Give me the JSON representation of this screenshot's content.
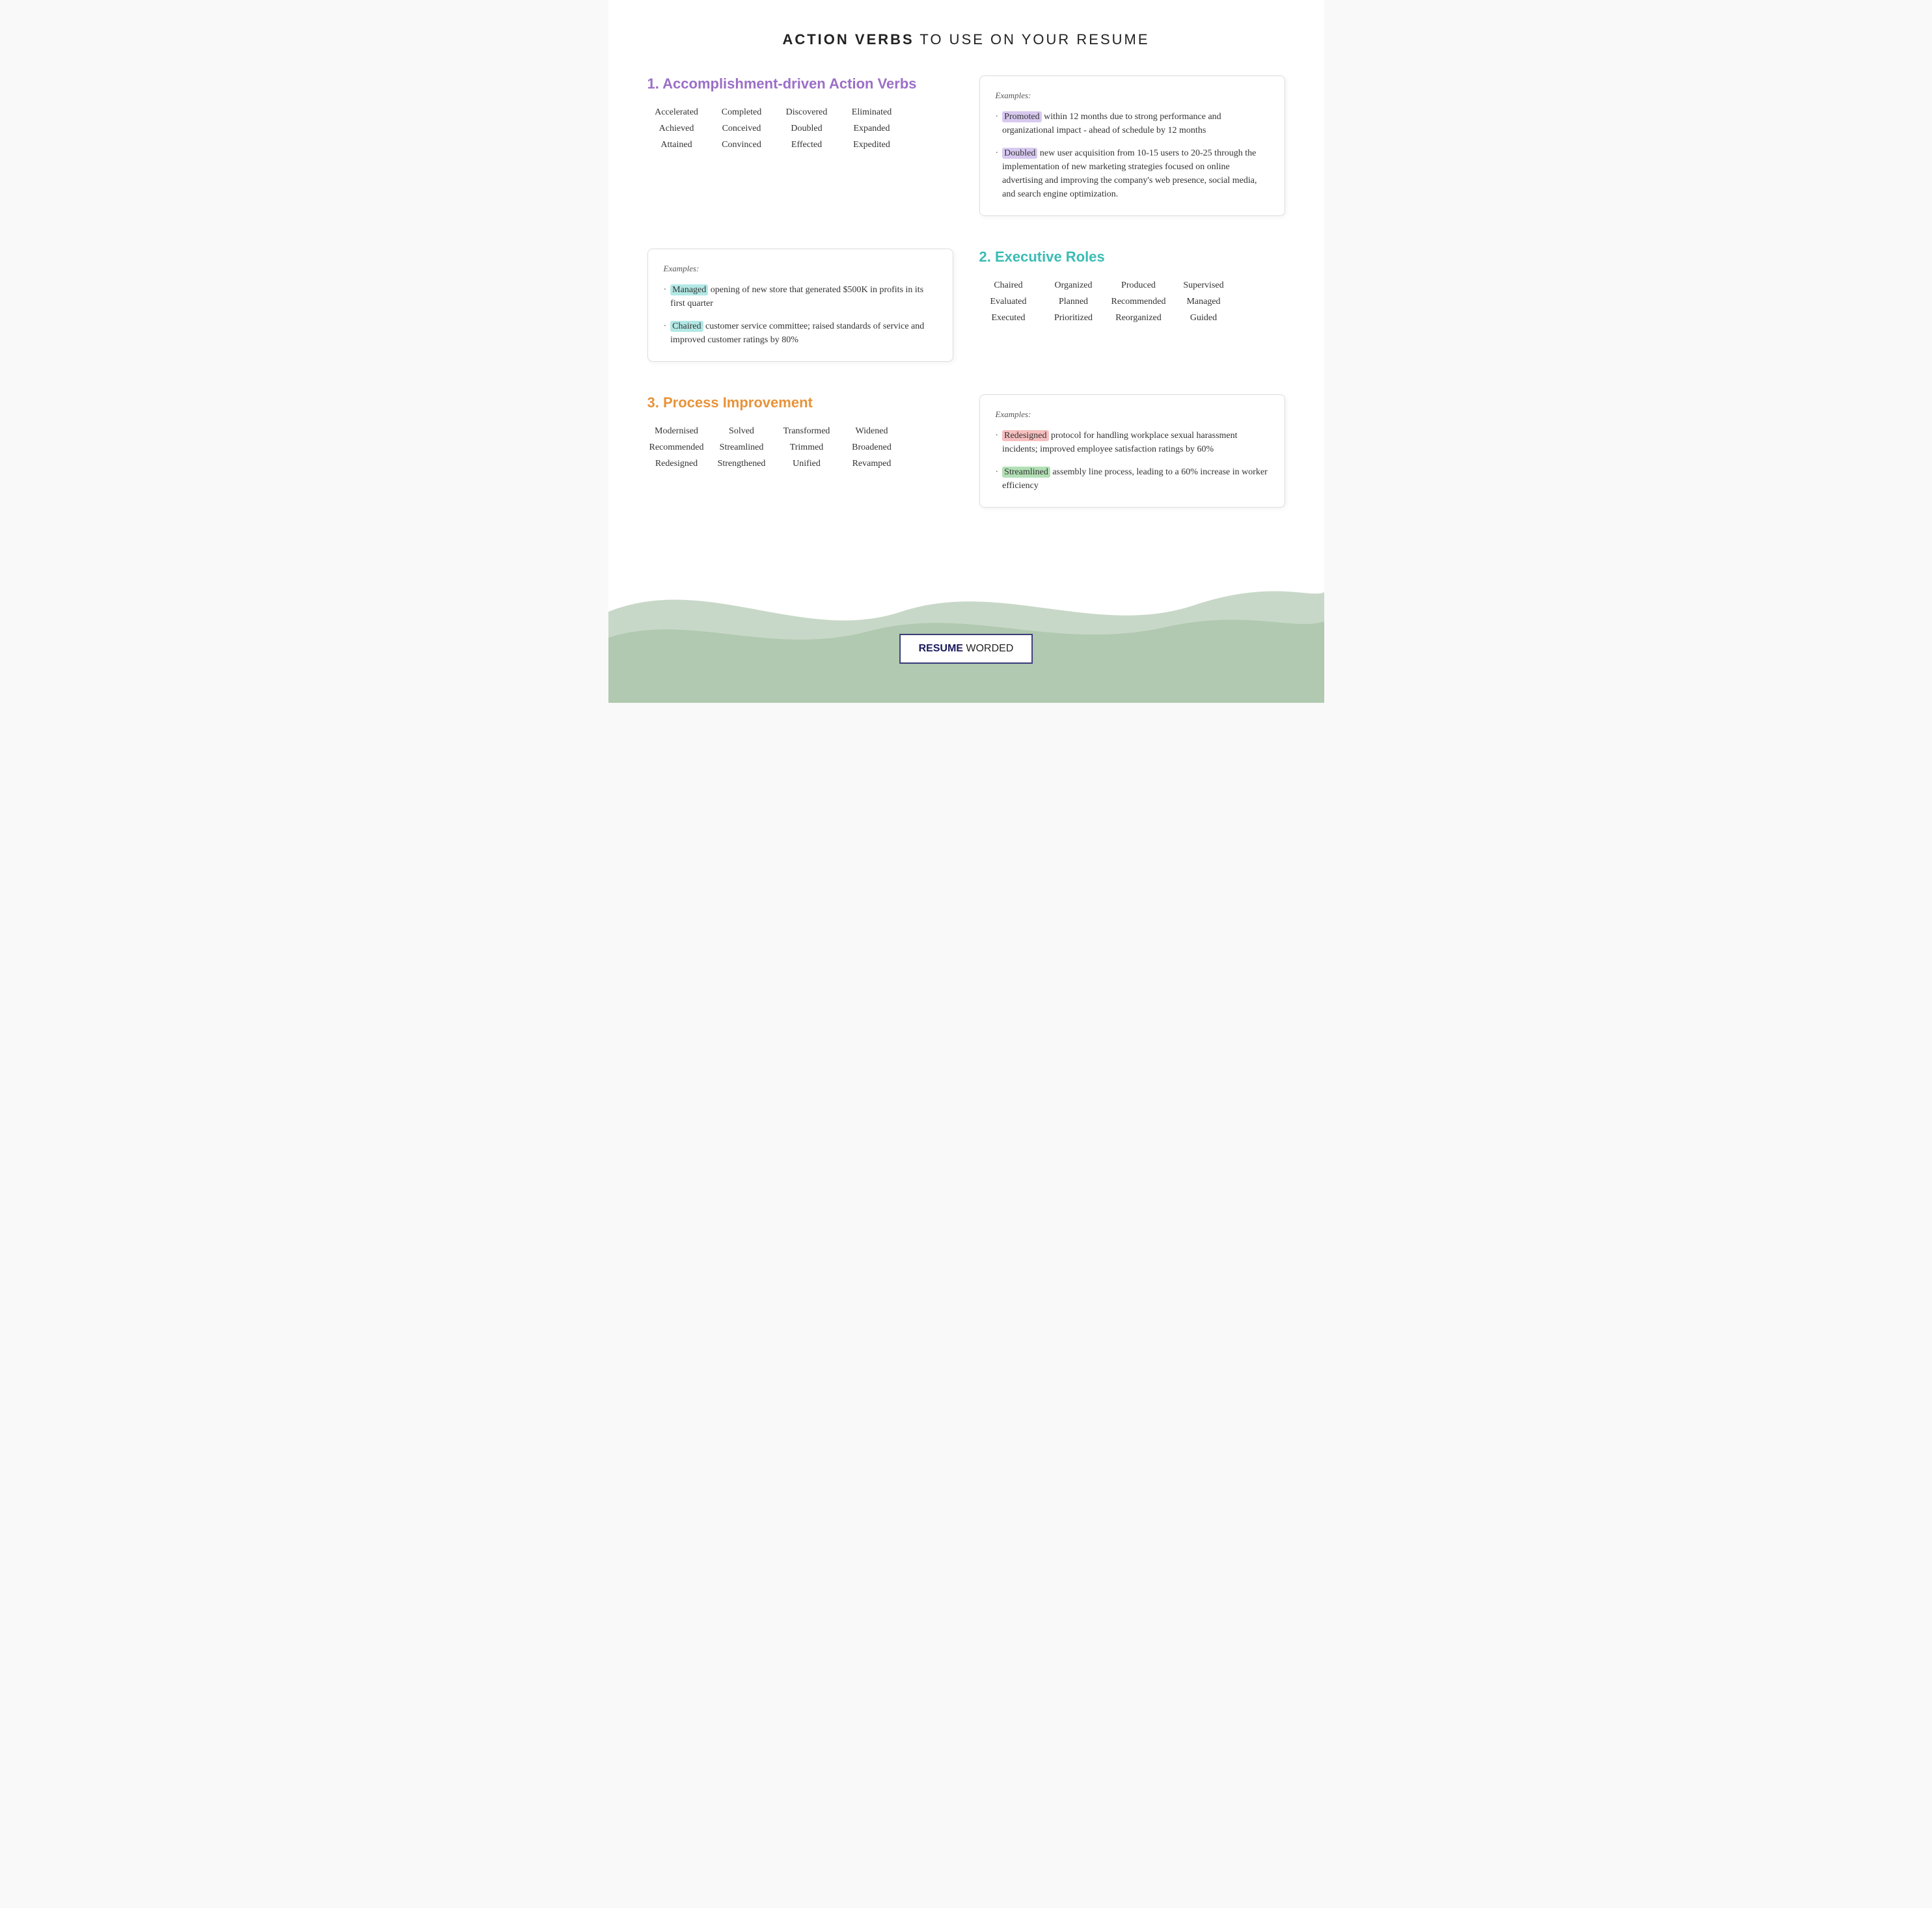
{
  "header": {
    "bold": "ACTION VERBS",
    "light": " TO USE ON YOUR RESUME"
  },
  "section1": {
    "title": "1. Accomplishment-driven Action Verbs",
    "color": "purple",
    "words": [
      [
        "Accelerated",
        "Achieved",
        "Attained"
      ],
      [
        "Completed",
        "Conceived",
        "Convinced"
      ],
      [
        "Discovered",
        "Doubled",
        "Effected"
      ],
      [
        "Eliminated",
        "Expanded",
        "Expedited"
      ]
    ],
    "examples_label": "Examples:",
    "examples": [
      {
        "highlight": "Promoted",
        "highlight_class": "hl-purple",
        "rest": " within 12 months due to strong performance and organizational impact - ahead of schedule by 12 months"
      },
      {
        "highlight": "Doubled",
        "highlight_class": "hl-purple",
        "rest": " new user acquisition from 10-15 users to 20-25 through the implementation of new marketing strategies focused on online advertising and improving the company's web presence, social media, and search engine optimization."
      }
    ]
  },
  "section1_left_examples": {
    "examples_label": "Examples:",
    "examples": [
      {
        "highlight": "Managed",
        "highlight_class": "hl-teal",
        "rest": " opening of new store that generated $500K in profits in its first quarter"
      },
      {
        "highlight": "Chaired",
        "highlight_class": "hl-teal",
        "rest": " customer service committee; raised standards of service and improved customer ratings by 80%"
      }
    ]
  },
  "section2": {
    "title": "2. Executive Roles",
    "color": "teal",
    "words": [
      [
        "Chaired",
        "Evaluated",
        "Executed"
      ],
      [
        "Organized",
        "Planned",
        "Prioritized"
      ],
      [
        "Produced",
        "Recommended",
        "Reorganized"
      ],
      [
        "Supervised",
        "Managed",
        "Guided"
      ]
    ]
  },
  "section3": {
    "title": "3. Process Improvement",
    "color": "orange",
    "words": [
      [
        "Modernised",
        "Recommended",
        "Redesigned"
      ],
      [
        "Solved",
        "Streamlined",
        "Strengthened"
      ],
      [
        "Transformed",
        "Trimmed",
        "Unified"
      ],
      [
        "Widened",
        "Broadened",
        "Revamped"
      ]
    ],
    "examples_label": "Examples:",
    "examples": [
      {
        "highlight": "Redesigned",
        "highlight_class": "hl-pink",
        "rest": " protocol for handling workplace sexual harassment incidents; improved employee satisfaction ratings by 60%"
      },
      {
        "highlight": "Streamlined",
        "highlight_class": "hl-green",
        "rest": " assembly line process, leading to a 60% increase in worker efficiency"
      }
    ]
  },
  "brand": {
    "bold": "RESUME",
    "light": " WORDED"
  },
  "wave": {
    "color1": "#c5d8c5",
    "color2": "#afc9af"
  }
}
